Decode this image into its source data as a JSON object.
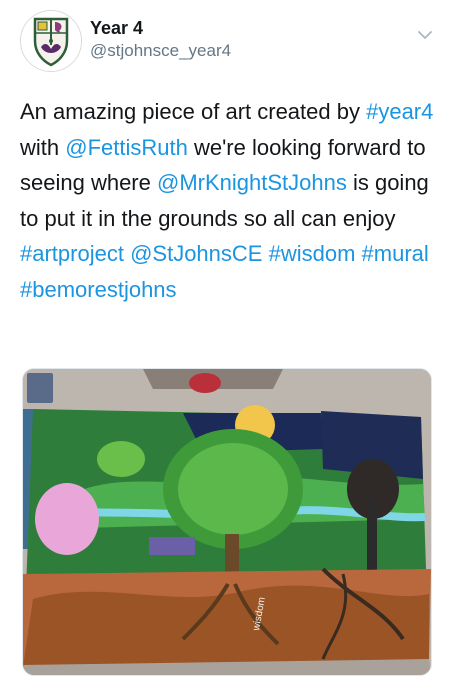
{
  "author": {
    "name": "Year 4",
    "handle": "@stjohnsce_year4"
  },
  "tweet": {
    "segments": [
      {
        "text": "An amazing piece of art created by ",
        "link": false
      },
      {
        "text": "#year4",
        "link": true
      },
      {
        "text": " with ",
        "link": false
      },
      {
        "text": "@FettisRuth",
        "link": true
      },
      {
        "text": " we're looking forward to seeing where ",
        "link": false
      },
      {
        "text": "@MrKnightStJohns",
        "link": true
      },
      {
        "text": " is going to put it in the grounds so all can enjoy ",
        "link": false
      },
      {
        "text": "#artproject",
        "link": true
      },
      {
        "text": " ",
        "link": false
      },
      {
        "text": "@StJohnsCE",
        "link": true
      },
      {
        "text": " ",
        "link": false
      },
      {
        "text": "#wisdom",
        "link": true
      },
      {
        "text": " ",
        "link": false
      },
      {
        "text": "#mural",
        "link": true
      },
      {
        "text": " ",
        "link": false
      },
      {
        "text": "#bemorestjohns",
        "link": true
      }
    ]
  },
  "media": {
    "painted_word": "wisdom"
  },
  "icons": {
    "avatar": "school-crest-icon",
    "more": "chevron-down-icon"
  },
  "colors": {
    "link": "#1b95e0",
    "handle": "#657786",
    "text": "#14171a"
  }
}
